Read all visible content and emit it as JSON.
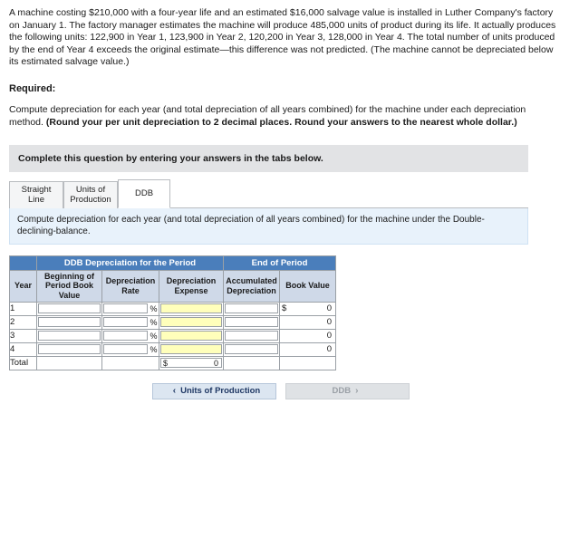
{
  "problem": {
    "text": "A machine costing $210,000 with a four-year life and an estimated $16,000 salvage value is installed in Luther Company's factory on January 1. The factory manager estimates the machine will produce 485,000 units of product during its life. It actually produces the following units: 122,900 in Year 1, 123,900 in Year 2, 120,200 in Year 3, 128,000 in Year 4. The total number of units produced by the end of Year 4 exceeds the original estimate—this difference was not predicted. (The machine cannot be depreciated below its estimated salvage value.)"
  },
  "required_label": "Required:",
  "compute": {
    "part1": "Compute depreciation for each year (and total depreciation of all years combined) for the machine under each depreciation method. ",
    "part2": "(Round your per unit depreciation to 2 decimal places. Round your answers to the nearest whole dollar.)"
  },
  "instruction_bar": {
    "text": "Complete this question by entering your answers in the tabs below."
  },
  "tabs": [
    {
      "label": "Straight Line",
      "active": false
    },
    {
      "label": "Units of Production",
      "active": false
    },
    {
      "label": "DDB",
      "active": true
    }
  ],
  "blue_note": {
    "text": "Compute depreciation for each year (and total depreciation of all years combined) for the machine under the Double-declining-balance."
  },
  "table": {
    "group_headers": {
      "ddb": "DDB Depreciation for the Period",
      "end": "End of Period"
    },
    "columns": [
      "Year",
      "Beginning of Period Book Value",
      "Depreciation Rate",
      "Depreciation Expense",
      "Accumulated Depreciation",
      "Book Value"
    ],
    "rows": [
      {
        "year": "1",
        "beginning": "",
        "rate": "",
        "rate_symbol": "%",
        "expense": "",
        "accumulated_symbol": "$",
        "accumulated": "",
        "book_value": "0"
      },
      {
        "year": "2",
        "beginning": "",
        "rate": "",
        "rate_symbol": "%",
        "expense": "",
        "accumulated_symbol": "",
        "accumulated": "",
        "book_value": "0"
      },
      {
        "year": "3",
        "beginning": "",
        "rate": "",
        "rate_symbol": "%",
        "expense": "",
        "accumulated_symbol": "",
        "accumulated": "",
        "book_value": "0"
      },
      {
        "year": "4",
        "beginning": "",
        "rate": "",
        "rate_symbol": "%",
        "expense": "",
        "accumulated_symbol": "",
        "accumulated": "",
        "book_value": "0"
      }
    ],
    "total_row": {
      "label": "Total",
      "symbol": "$",
      "value": "0"
    }
  },
  "nav": {
    "prev_label": "Units of Production",
    "prev_chevron": "‹",
    "next_label": "DDB",
    "next_chevron": "›"
  },
  "colors": {
    "header_blue": "#4a7ebb",
    "header_light": "#cfd9e8",
    "input_highlight": "#ffffbb",
    "note_bg": "#e8f2fb",
    "instruction_bg": "#e2e3e5"
  }
}
